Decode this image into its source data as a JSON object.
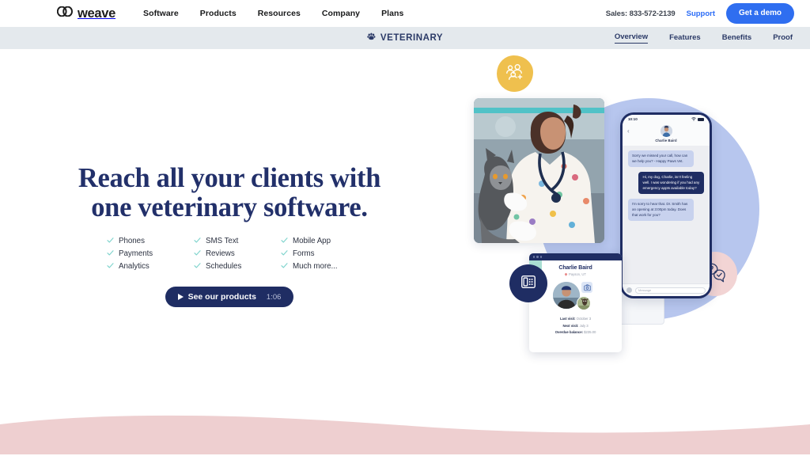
{
  "brand": {
    "name": "weave",
    "logo_icon": "weave-loops-logo",
    "colors": {
      "navy": "#1f2d63",
      "headline_navy": "#22306a",
      "blue_cta": "#2f6ef0",
      "support_blue": "#2b6cf6",
      "subnav_bg": "#e4e9ed",
      "check_teal": "#7fd4cd",
      "badge_yellow": "#efc04e",
      "badge_pink": "#f2d4d4",
      "blob_blue": "#b7c6ee",
      "wave_pink": "#eecfd0"
    }
  },
  "topnav": {
    "links": [
      {
        "label": "Software"
      },
      {
        "label": "Products"
      },
      {
        "label": "Resources"
      },
      {
        "label": "Company"
      },
      {
        "label": "Plans"
      }
    ],
    "sales": "Sales: 833-572-2139",
    "support_label": "Support",
    "demo_button": "Get a demo"
  },
  "subnav": {
    "icon": "paw-print-icon",
    "title": "VETERINARY",
    "tabs": [
      {
        "label": "Overview",
        "active": true
      },
      {
        "label": "Features",
        "active": false
      },
      {
        "label": "Benefits",
        "active": false
      },
      {
        "label": "Proof",
        "active": false
      }
    ]
  },
  "hero": {
    "headline_line1": "Reach all your clients with",
    "headline_line2": "one veterinary software.",
    "features": [
      "Phones",
      "SMS Text",
      "Mobile App",
      "Payments",
      "Reviews",
      "Forms",
      "Analytics",
      "Schedules",
      "Much more..."
    ],
    "video_button": {
      "icon": "play-icon",
      "label": "See our products",
      "duration": "1:06"
    }
  },
  "art": {
    "badges": [
      {
        "name": "add-contacts-badge",
        "icon": "people-plus-icon",
        "color": "#efc04e"
      },
      {
        "name": "messaging-badge",
        "icon": "chat-question-check-icon",
        "color": "#f2d4d4"
      },
      {
        "name": "phone-badge",
        "icon": "desk-phone-icon",
        "color": "#1f2d63"
      }
    ],
    "photo_alt": "veterinarian-holding-cat",
    "phone": {
      "status_time": "10:10",
      "status_icons": [
        "wifi-icon",
        "battery-icon"
      ],
      "back_icon": "chevron-left-icon",
      "contact_name": "Charlie Baird",
      "messages": [
        {
          "from": "them",
          "text": "Sorry we missed your call, how can we help you? - Happy Paws Vet."
        },
        {
          "from": "me",
          "text": "Hi, my dog, Charlie, isn't feeling well. I was wondering if you had any emergency appts available today?"
        },
        {
          "from": "them",
          "text": "I'm sorry to hear that. Dr. Smith has an opening at 3:00pm today. Does that work for you?"
        }
      ],
      "compose_placeholder": "Message"
    },
    "patient_card": {
      "name": "Charlie Baird",
      "location": "Payson, UT",
      "details": [
        {
          "label": "Last visit:",
          "value": "October 3"
        },
        {
          "label": "Next visit:",
          "value": "July 3"
        },
        {
          "label": "Overdue balance:",
          "value": "$235.00"
        }
      ]
    }
  }
}
